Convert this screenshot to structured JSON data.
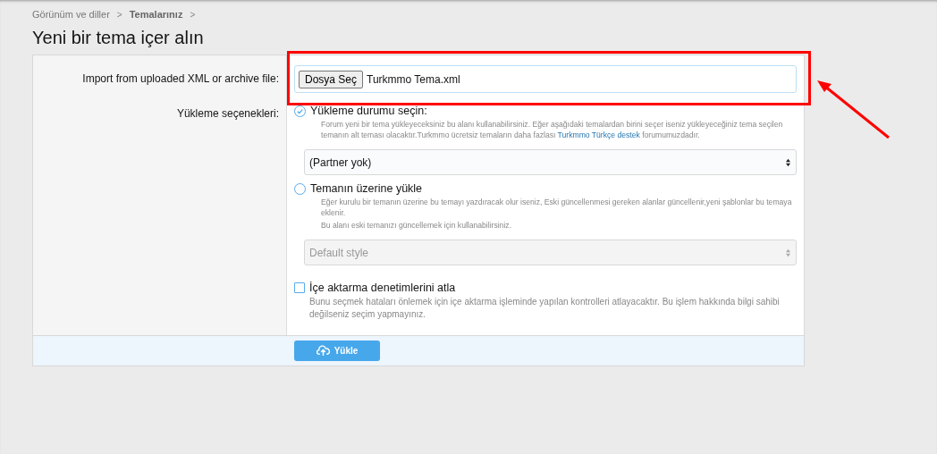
{
  "breadcrumb": [
    {
      "label": "Görünüm ve diller",
      "current": false
    },
    {
      "label": "Temalarınız",
      "current": true
    }
  ],
  "breadcrumb_separator": ">",
  "title": "Yeni bir tema içer alın",
  "file_row": {
    "label": "Import from uploaded XML or archive file:",
    "button": "Dosya Seç",
    "file_name": "Turkmmo Tema.xml"
  },
  "options_label": "Yükleme seçenekleri:",
  "options": [
    {
      "label": "Yükleme durumu seçin:",
      "selected": true,
      "hint": [
        {
          "text": "Forum yeni bir tema yükleyeceksiniz bu alanı kullanabilirsiniz. Eğer aşağıdaki temalardan birini seçer iseniz yükleyeceğiniz tema seçilen temanın alt teması olacaktır.Turkmmo ücretsiz temaların daha fazlası ",
          "link": "Turkmmo Türkçe destek",
          "after": " forumumuzdadır."
        }
      ],
      "select": {
        "value": "(Partner yok)",
        "disabled": false
      }
    },
    {
      "label": "Temanın üzerine yükle",
      "selected": false,
      "hint": [
        {
          "text": "Eğer kurulu bir temanın üzerine bu temayı yazdıracak olur iseniz, Eski güncellenmesi gereken alanlar güncellenir,yeni şablonlar bu temaya eklenir."
        },
        {
          "text": "Bu alanı eski temanızı güncellemek için kullanabilirsiniz."
        }
      ],
      "select": {
        "value": "Default style",
        "disabled": true
      }
    }
  ],
  "skip_checks": {
    "label": "İçe aktarma denetimlerini atla",
    "checked": false,
    "hint": "Bunu seçmek hataları önlemek için içe aktarma işleminde yapılan kontrolleri atlayacaktır. Bu işlem hakkında bilgi sahibi değilseniz seçim yapmayınız."
  },
  "submit_button": "Yükle"
}
